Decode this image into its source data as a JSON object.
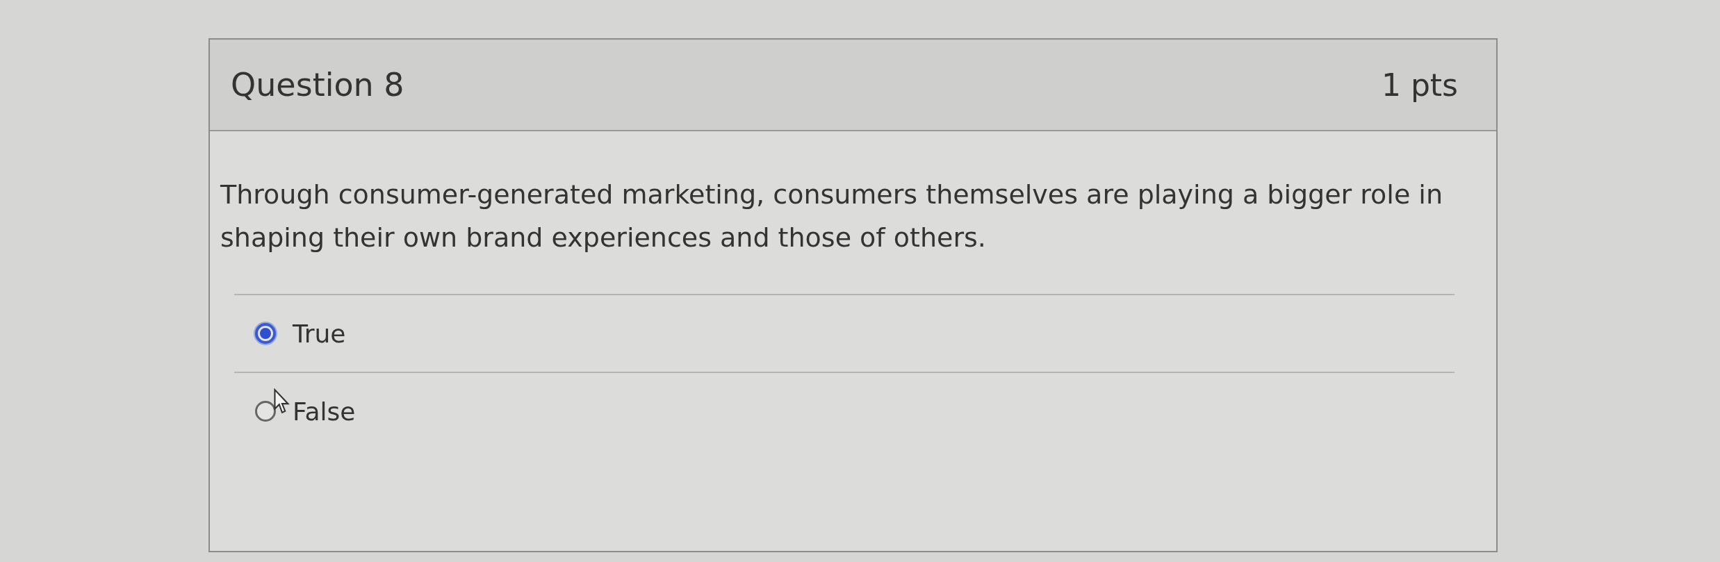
{
  "question": {
    "title": "Question 8",
    "points": "1 pts",
    "text": "Through consumer-generated marketing, consumers themselves are playing a bigger role in shaping their own brand experiences and those of others."
  },
  "answers": [
    {
      "label": "True",
      "selected": true
    },
    {
      "label": "False",
      "selected": false
    }
  ]
}
